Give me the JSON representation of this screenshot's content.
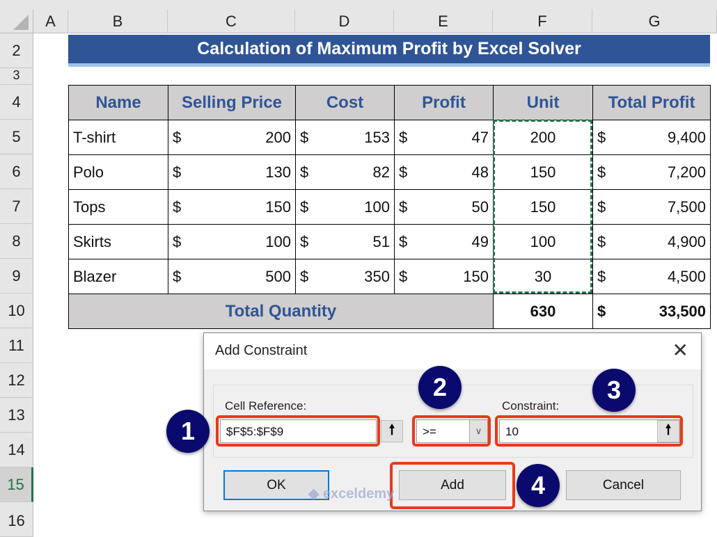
{
  "columns": [
    "A",
    "B",
    "C",
    "D",
    "E",
    "F",
    "G"
  ],
  "rows": [
    "2",
    "3",
    "4",
    "5",
    "6",
    "7",
    "8",
    "9",
    "10",
    "11",
    "12",
    "13",
    "14",
    "15",
    "16"
  ],
  "title": "Calculation of Maximum Profit by Excel Solver",
  "table": {
    "headers": [
      "Name",
      "Selling Price",
      "Cost",
      "Profit",
      "Unit",
      "Total Profit"
    ],
    "currency": "$",
    "rows": [
      [
        "T-shirt",
        "200",
        "153",
        "47",
        "200",
        "9,400"
      ],
      [
        "Polo",
        "130",
        "82",
        "48",
        "150",
        "7,200"
      ],
      [
        "Tops",
        "150",
        "100",
        "50",
        "150",
        "7,500"
      ],
      [
        "Skirts",
        "100",
        "51",
        "49",
        "100",
        "4,900"
      ],
      [
        "Blazer",
        "500",
        "350",
        "150",
        "30",
        "4,500"
      ]
    ],
    "total_label": "Total Quantity",
    "total_units": "630",
    "total_profit": "33,500"
  },
  "dialog": {
    "title": "Add Constraint",
    "cell_ref_label": "Cell Reference:",
    "cell_ref_value": "$F$5:$F$9",
    "operator": ">=",
    "constraint_label": "Constraint:",
    "constraint_value": "10",
    "ok": "OK",
    "add": "Add",
    "cancel": "Cancel"
  },
  "steps": [
    "1",
    "2",
    "3",
    "4"
  ],
  "watermark": "exceldemy",
  "colors": {
    "banner": "#2f5597",
    "highlight": "#e8391c",
    "step_circle": "#0a0a6e",
    "selection": "#217346"
  }
}
